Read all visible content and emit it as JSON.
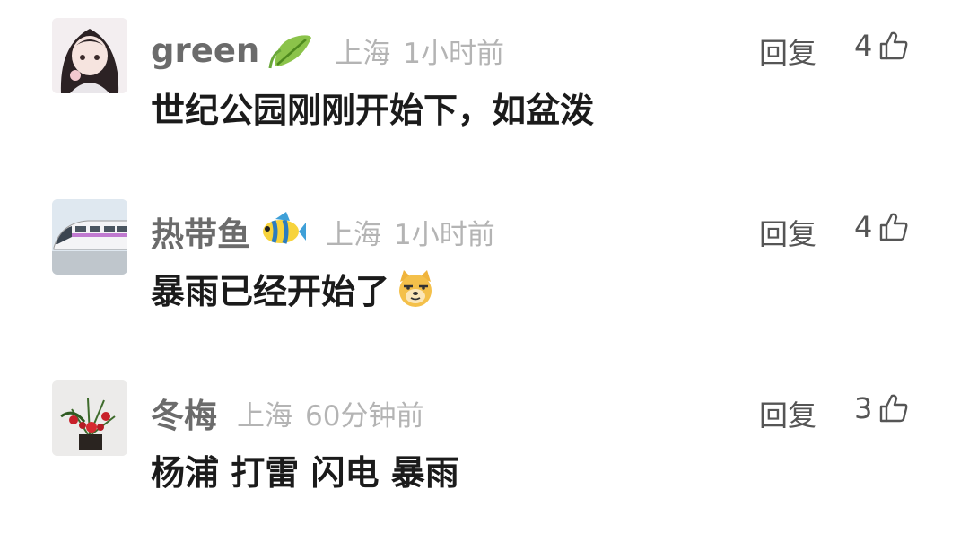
{
  "comments": [
    {
      "username": "green",
      "username_badge_icon": "leaf-icon",
      "location": "上海",
      "time": "1小时前",
      "reply_label": "回复",
      "likes": "4",
      "text": "世纪公园刚刚开始下，如盆泼"
    },
    {
      "username": "热带鱼",
      "username_badge_icon": "tropical-fish-icon",
      "location": "上海",
      "time": "1小时前",
      "reply_label": "回复",
      "likes": "4",
      "text": "暴雨已经开始了",
      "emoji_icon": "doge-face-icon"
    },
    {
      "username": "冬梅",
      "location": "上海",
      "time": "60分钟前",
      "reply_label": "回复",
      "likes": "3",
      "text": "杨浦 打雷 闪电 暴雨"
    }
  ],
  "colors": {
    "username": "#6b6b6b",
    "meta": "#b4b4b4",
    "content": "#1b1b1b",
    "action": "#555555"
  }
}
